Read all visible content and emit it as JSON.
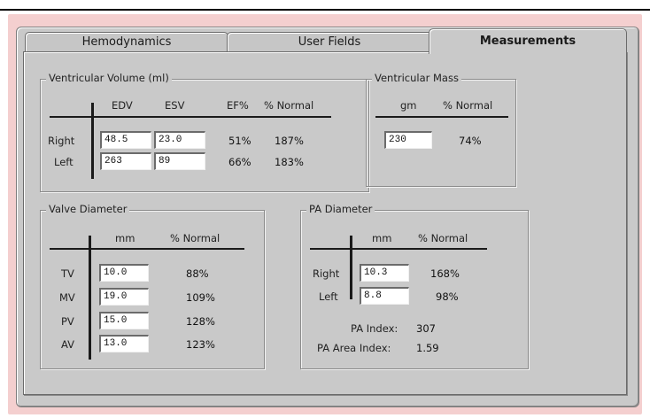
{
  "tabs": [
    {
      "label": "Hemodynamics",
      "active": false
    },
    {
      "label": "User Fields",
      "active": false
    },
    {
      "label": "Measurements",
      "active": true
    }
  ],
  "ventricular_volume": {
    "title": "Ventricular Volume (ml)",
    "headers": [
      "EDV",
      "ESV",
      "EF%",
      "% Normal"
    ],
    "rows": [
      {
        "label": "Right",
        "edv": "48.5",
        "esv": "23.0",
        "ef": "51%",
        "normal": "187%"
      },
      {
        "label": "Left",
        "edv": "263",
        "esv": "89",
        "ef": "66%",
        "normal": "183%"
      }
    ]
  },
  "ventricular_mass": {
    "title": "Ventricular Mass",
    "headers": [
      "gm",
      "% Normal"
    ],
    "value": "230",
    "normal": "74%"
  },
  "valve_diameter": {
    "title": "Valve Diameter",
    "headers": [
      "mm",
      "% Normal"
    ],
    "rows": [
      {
        "label": "TV",
        "value": "10.0",
        "normal": "88%"
      },
      {
        "label": "MV",
        "value": "19.0",
        "normal": "109%"
      },
      {
        "label": "PV",
        "value": "15.0",
        "normal": "128%"
      },
      {
        "label": "AV",
        "value": "13.0",
        "normal": "123%"
      }
    ]
  },
  "pa_diameter": {
    "title": "PA Diameter",
    "headers": [
      "mm",
      "% Normal"
    ],
    "rows": [
      {
        "label": "Right",
        "value": "10.3",
        "normal": "168%"
      },
      {
        "label": "Left",
        "value": "8.8",
        "normal": "98%"
      }
    ],
    "pa_index_label": "PA Index:",
    "pa_index_value": "307",
    "pa_area_index_label": "PA Area Index:",
    "pa_area_index_value": "1.59"
  }
}
